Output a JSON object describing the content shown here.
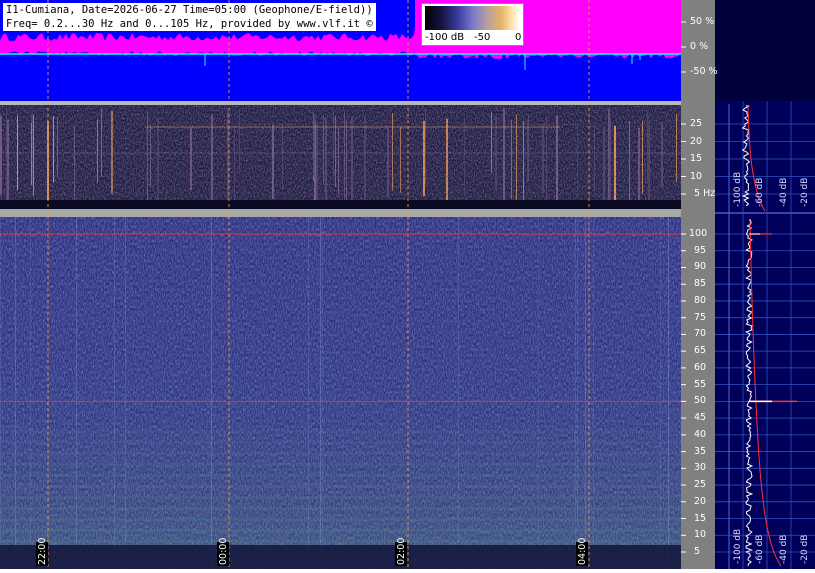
{
  "header": {
    "line1": "I1-Cumiana, Date=2026-06-27 Time=05:00 (Geophone/E-field))",
    "line2": "Freq= 0.2...30 Hz and 0...105 Hz, provided by www.vlf.it ©"
  },
  "colorbar": {
    "labels": [
      "-100 dB",
      "-50",
      "0"
    ],
    "colors": [
      "#000000",
      "#3c3ca0",
      "#b4a0a0",
      "#ffe6b4",
      "#ffffff"
    ]
  },
  "colors": {
    "amplitude_fill": "#ff00ff",
    "amplitude_bg": "#0000ff",
    "trace": "#00ffff",
    "spectrogram_bg": "#2b2f78",
    "spectrum_panel_bg": "#00005a",
    "axis_panel_bg": "#808080",
    "marker_line": "#ff3030"
  },
  "chart_data": [
    {
      "type": "area",
      "panel": "amplitude",
      "yticks": [
        "50 %",
        "0 %",
        "-50 %"
      ],
      "ylim": [
        -100,
        100
      ],
      "grid": true
    },
    {
      "type": "heatmap",
      "panel": "low-frequency spectrogram",
      "ylabel": "Hz",
      "yticks": [
        "25",
        "20",
        "15",
        "10",
        "5 Hz"
      ],
      "ylim": [
        0.2,
        30
      ],
      "spectrum_labels": [
        "-100 dB",
        "-60 dB",
        "-40 dB",
        "-20 dB"
      ]
    },
    {
      "type": "heatmap",
      "panel": "full spectrogram",
      "yticks": [
        "100",
        "95",
        "90",
        "85",
        "80",
        "75",
        "70",
        "65",
        "60",
        "55",
        "50",
        "45",
        "40",
        "35",
        "30",
        "25",
        "20",
        "15",
        "10",
        "5"
      ],
      "ylim": [
        0,
        105
      ],
      "time_labels": [
        "22:00",
        "00:00",
        "02:00",
        "04:00"
      ],
      "marker_lines_hz": [
        100,
        50
      ],
      "spectrum_labels": [
        "-100 dB",
        "-60 dB",
        "-40 dB",
        "-20 dB"
      ]
    }
  ]
}
